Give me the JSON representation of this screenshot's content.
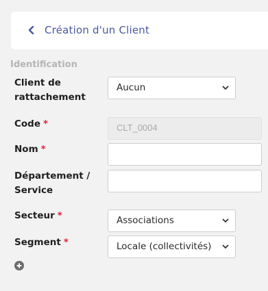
{
  "header": {
    "title": "Création d'un Client"
  },
  "section": {
    "title": "Identification"
  },
  "fields": {
    "client_rattachement": {
      "label_line1": "Client de",
      "label_line2": "rattachement",
      "value": "Aucun"
    },
    "code": {
      "label": "Code",
      "required": "*",
      "value": "CLT_0004"
    },
    "nom": {
      "label": "Nom",
      "required": "*",
      "value": ""
    },
    "departement": {
      "label_line1": "Département /",
      "label_line2": "Service",
      "value": ""
    },
    "secteur": {
      "label": "Secteur",
      "required": "*",
      "value": "Associations"
    },
    "segment": {
      "label": "Segment",
      "required": "*",
      "value": "Locale (collectivités)"
    }
  },
  "icons": {
    "back": "chevron-left-icon",
    "add": "plus-circle-icon",
    "dropdown": "chevron-down-icon"
  },
  "colors": {
    "title": "#4a57a0",
    "required": "#e0203a",
    "section": "#b5b5b5"
  }
}
